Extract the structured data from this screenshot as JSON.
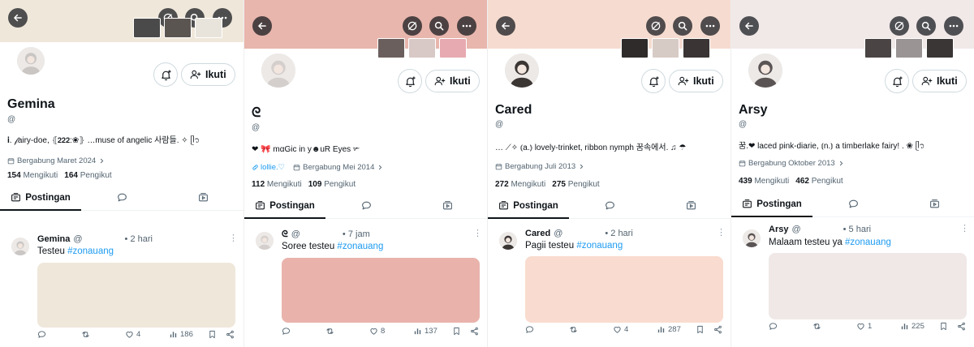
{
  "common": {
    "follow_label": "Ikuti",
    "following_label": "Mengikuti",
    "followers_label": "Pengikut",
    "tabs": [
      "Postingan",
      "",
      ""
    ],
    "handle_at": "@"
  },
  "profiles": [
    {
      "banner_color": "#efe7da",
      "thumb_colors": [
        "#4a4a4a",
        "#5b5552",
        "#e8e4dc"
      ],
      "avatar_tone": "#c9c6c4",
      "name": "Gemina",
      "handle": "@",
      "bio": "𝐢. 𝒻airy-doe, ⦃𝟮𝟮𝟮:❀⦄ …muse of angelic 사람들. ✧ ᥫ᭡",
      "meta_link": "",
      "meta_joined": "Bergabung Maret 2024",
      "following": "154",
      "followers": "164",
      "post": {
        "name": "Gemina",
        "handle": "@",
        "time": "• 2 hari",
        "text": "Testeu",
        "hashtag": "#zonauang",
        "media_color": "#efe7da",
        "likes": "4",
        "views": "186"
      }
    },
    {
      "banner_color": "#e8b6ad",
      "thumb_colors": [
        "#6b5f5e",
        "#d8c9c6",
        "#e7aab0"
      ],
      "avatar_tone": "#d4cfcd",
      "name": "ᘓ",
      "handle": "@",
      "bio": "❤ 🎀 mαGic in y☻uR Eyes ✃",
      "meta_link": "lollie.♡",
      "meta_joined": "Bergabung Mei 2014",
      "following": "112",
      "followers": "109",
      "post": {
        "name": "ᘓ",
        "handle": "@",
        "time": "• 7 jam",
        "text": "Soree testeu",
        "hashtag": "#zonauang",
        "media_color": "#e9b3ac",
        "likes": "8",
        "views": "137"
      }
    },
    {
      "banner_color": "#f6dcd0",
      "thumb_colors": [
        "#2f2b2a",
        "#d7cbc5",
        "#3a3534"
      ],
      "avatar_tone": "#3b3634",
      "name": "Cared",
      "handle": "@",
      "bio": "… ⟋✧ ⦅a.⦆ lovely-trinket, ribbon nymph 꿈속에서. ♫ ☂",
      "meta_link": "",
      "meta_joined": "Bergabung Juli 2013",
      "following": "272",
      "followers": "275",
      "post": {
        "name": "Cared",
        "handle": "@",
        "time": "• 2 hari",
        "text": "Pagii testeu",
        "hashtag": "#zonauang",
        "media_color": "#f9dccf",
        "likes": "4",
        "views": "287"
      }
    },
    {
      "banner_color": "#f1e8e8",
      "thumb_colors": [
        "#4a4444",
        "#9a9494",
        "#3b3636"
      ],
      "avatar_tone": "#5a5454",
      "name": "Arsy",
      "handle": "@",
      "bio": "꿈.❤ laced pink-diarie, ⦅n.⦆ a timberlake fairy! . ❀ ᥫ᭡",
      "meta_link": "",
      "meta_joined": "Bergabung Oktober 2013",
      "following": "439",
      "followers": "462",
      "post": {
        "name": "Arsy",
        "handle": "@",
        "time": "• 5 hari",
        "text": "Malaam testeu ya",
        "hashtag": "#zonauang",
        "media_color": "#f0e7e7",
        "likes": "1",
        "views": "225"
      }
    }
  ]
}
